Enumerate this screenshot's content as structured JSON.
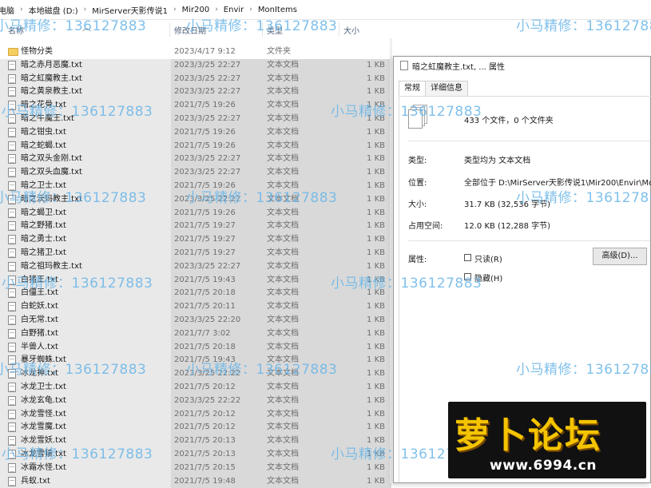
{
  "breadcrumb": [
    "电脑",
    "本地磁盘 (D:)",
    "MirServer天影传说1",
    "Mir200",
    "Envir",
    "MonItems"
  ],
  "columns": {
    "name": "名称",
    "date": "修改日期",
    "type": "类型",
    "size": "大小"
  },
  "files": [
    {
      "name": "怪物分类",
      "date": "2023/4/17 9:12",
      "type": "文件夹",
      "size": "",
      "folder": true
    },
    {
      "name": "暗之赤月恶魔.txt",
      "date": "2023/3/25 22:27",
      "type": "文本文档",
      "size": "1 KB"
    },
    {
      "name": "暗之虹魔教主.txt",
      "date": "2023/3/25 22:27",
      "type": "文本文档",
      "size": "1 KB"
    },
    {
      "name": "暗之黄泉教主.txt",
      "date": "2023/3/25 22:27",
      "type": "文本文档",
      "size": "1 KB"
    },
    {
      "name": "暗之花骨.txt",
      "date": "2021/7/5 19:26",
      "type": "文本文档",
      "size": "1 KB"
    },
    {
      "name": "暗之牛魔王.txt",
      "date": "2023/3/25 22:27",
      "type": "文本文档",
      "size": "1 KB"
    },
    {
      "name": "暗之钳虫.txt",
      "date": "2021/7/5 19:26",
      "type": "文本文档",
      "size": "1 KB"
    },
    {
      "name": "暗之蛇蝎.txt",
      "date": "2021/7/5 19:26",
      "type": "文本文档",
      "size": "1 KB"
    },
    {
      "name": "暗之双头金刚.txt",
      "date": "2023/3/25 22:27",
      "type": "文本文档",
      "size": "1 KB"
    },
    {
      "name": "暗之双头血魔.txt",
      "date": "2023/3/25 22:27",
      "type": "文本文档",
      "size": "1 KB"
    },
    {
      "name": "暗之卫士.txt",
      "date": "2021/7/5 19:26",
      "type": "文本文档",
      "size": "1 KB"
    },
    {
      "name": "暗之沃玛教主.txt",
      "date": "2023/3/25 22:27",
      "type": "文本文档",
      "size": "1 KB"
    },
    {
      "name": "暗之蝎卫.txt",
      "date": "2021/7/5 19:26",
      "type": "文本文档",
      "size": "1 KB"
    },
    {
      "name": "暗之野猪.txt",
      "date": "2021/7/5 19:27",
      "type": "文本文档",
      "size": "1 KB"
    },
    {
      "name": "暗之勇士.txt",
      "date": "2021/7/5 19:27",
      "type": "文本文档",
      "size": "1 KB"
    },
    {
      "name": "暗之猪卫.txt",
      "date": "2021/7/5 19:27",
      "type": "文本文档",
      "size": "1 KB"
    },
    {
      "name": "暗之祖玛教主.txt",
      "date": "2023/3/25 22:27",
      "type": "文本文档",
      "size": "1 KB"
    },
    {
      "name": "白猪王.txt",
      "date": "2021/7/5 19:43",
      "type": "文本文档",
      "size": "1 KB"
    },
    {
      "name": "白僵王.txt",
      "date": "2021/7/5 20:18",
      "type": "文本文档",
      "size": "1 KB"
    },
    {
      "name": "白蛇妖.txt",
      "date": "2021/7/5 20:11",
      "type": "文本文档",
      "size": "1 KB"
    },
    {
      "name": "白无常.txt",
      "date": "2023/3/25 22:20",
      "type": "文本文档",
      "size": "1 KB"
    },
    {
      "name": "白野猪.txt",
      "date": "2021/7/7 3:02",
      "type": "文本文档",
      "size": "1 KB"
    },
    {
      "name": "半兽人.txt",
      "date": "2021/7/5 20:18",
      "type": "文本文档",
      "size": "1 KB"
    },
    {
      "name": "暴牙蜘蛛.txt",
      "date": "2021/7/5 19:43",
      "type": "文本文档",
      "size": "1 KB"
    },
    {
      "name": "冰龙神.txt",
      "date": "2023/3/25 22:22",
      "type": "文本文档",
      "size": "1 KB"
    },
    {
      "name": "冰龙卫士.txt",
      "date": "2021/7/5 20:12",
      "type": "文本文档",
      "size": "1 KB"
    },
    {
      "name": "冰龙玄龟.txt",
      "date": "2023/3/25 22:22",
      "type": "文本文档",
      "size": "1 KB"
    },
    {
      "name": "冰龙雪怪.txt",
      "date": "2021/7/5 20:12",
      "type": "文本文档",
      "size": "1 KB"
    },
    {
      "name": "冰龙雪魔.txt",
      "date": "2021/7/5 20:12",
      "type": "文本文档",
      "size": "1 KB"
    },
    {
      "name": "冰龙雪妖.txt",
      "date": "2021/7/5 20:13",
      "type": "文本文档",
      "size": "1 KB"
    },
    {
      "name": "冰龙雪猿.txt",
      "date": "2021/7/5 20:13",
      "type": "文本文档",
      "size": "1 KB"
    },
    {
      "name": "冰霜水怪.txt",
      "date": "2021/7/5 20:15",
      "type": "文本文档",
      "size": "1 KB"
    },
    {
      "name": "兵蚁.txt",
      "date": "2021/7/5 19:48",
      "type": "文本文档",
      "size": "1 KB"
    }
  ],
  "dialog": {
    "title": "暗之虹魔教主.txt, ... 属性",
    "tabs": [
      "常规",
      "详细信息"
    ],
    "count": "433 个文件，0 个文件夹",
    "type_label": "类型:",
    "type_value": "类型均为 文本文档",
    "location_label": "位置:",
    "location_value": "全部位于 D:\\MirServer天影传说1\\Mir200\\Envir\\Mo",
    "size_label": "大小:",
    "size_value": "31.7 KB (32,536 字节)",
    "disk_label": "占用空间:",
    "disk_value": "12.0 KB (12,288 字节)",
    "attr_label": "属性:",
    "readonly": "只读(R)",
    "hidden": "隐藏(H)",
    "advanced": "高级(D)..."
  },
  "watermark": "小马精修：136127883",
  "watermark_color": "#6bb6e8",
  "logo": {
    "title": "萝卜论坛",
    "site": "www.6994.cn"
  }
}
